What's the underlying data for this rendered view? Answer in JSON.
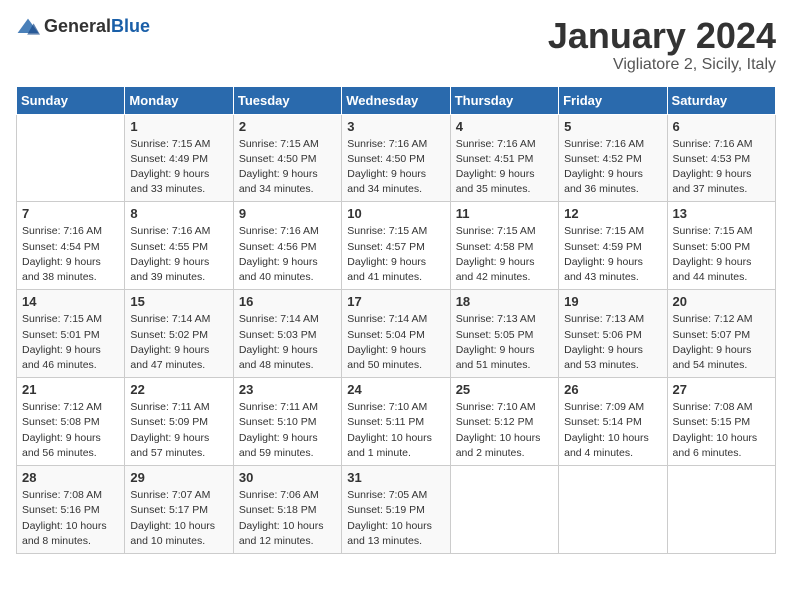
{
  "header": {
    "logo_general": "General",
    "logo_blue": "Blue",
    "title": "January 2024",
    "subtitle": "Vigliatore 2, Sicily, Italy"
  },
  "days_of_week": [
    "Sunday",
    "Monday",
    "Tuesday",
    "Wednesday",
    "Thursday",
    "Friday",
    "Saturday"
  ],
  "weeks": [
    [
      {
        "day": "",
        "info": ""
      },
      {
        "day": "1",
        "info": "Sunrise: 7:15 AM\nSunset: 4:49 PM\nDaylight: 9 hours\nand 33 minutes."
      },
      {
        "day": "2",
        "info": "Sunrise: 7:15 AM\nSunset: 4:50 PM\nDaylight: 9 hours\nand 34 minutes."
      },
      {
        "day": "3",
        "info": "Sunrise: 7:16 AM\nSunset: 4:50 PM\nDaylight: 9 hours\nand 34 minutes."
      },
      {
        "day": "4",
        "info": "Sunrise: 7:16 AM\nSunset: 4:51 PM\nDaylight: 9 hours\nand 35 minutes."
      },
      {
        "day": "5",
        "info": "Sunrise: 7:16 AM\nSunset: 4:52 PM\nDaylight: 9 hours\nand 36 minutes."
      },
      {
        "day": "6",
        "info": "Sunrise: 7:16 AM\nSunset: 4:53 PM\nDaylight: 9 hours\nand 37 minutes."
      }
    ],
    [
      {
        "day": "7",
        "info": "Sunrise: 7:16 AM\nSunset: 4:54 PM\nDaylight: 9 hours\nand 38 minutes."
      },
      {
        "day": "8",
        "info": "Sunrise: 7:16 AM\nSunset: 4:55 PM\nDaylight: 9 hours\nand 39 minutes."
      },
      {
        "day": "9",
        "info": "Sunrise: 7:16 AM\nSunset: 4:56 PM\nDaylight: 9 hours\nand 40 minutes."
      },
      {
        "day": "10",
        "info": "Sunrise: 7:15 AM\nSunset: 4:57 PM\nDaylight: 9 hours\nand 41 minutes."
      },
      {
        "day": "11",
        "info": "Sunrise: 7:15 AM\nSunset: 4:58 PM\nDaylight: 9 hours\nand 42 minutes."
      },
      {
        "day": "12",
        "info": "Sunrise: 7:15 AM\nSunset: 4:59 PM\nDaylight: 9 hours\nand 43 minutes."
      },
      {
        "day": "13",
        "info": "Sunrise: 7:15 AM\nSunset: 5:00 PM\nDaylight: 9 hours\nand 44 minutes."
      }
    ],
    [
      {
        "day": "14",
        "info": "Sunrise: 7:15 AM\nSunset: 5:01 PM\nDaylight: 9 hours\nand 46 minutes."
      },
      {
        "day": "15",
        "info": "Sunrise: 7:14 AM\nSunset: 5:02 PM\nDaylight: 9 hours\nand 47 minutes."
      },
      {
        "day": "16",
        "info": "Sunrise: 7:14 AM\nSunset: 5:03 PM\nDaylight: 9 hours\nand 48 minutes."
      },
      {
        "day": "17",
        "info": "Sunrise: 7:14 AM\nSunset: 5:04 PM\nDaylight: 9 hours\nand 50 minutes."
      },
      {
        "day": "18",
        "info": "Sunrise: 7:13 AM\nSunset: 5:05 PM\nDaylight: 9 hours\nand 51 minutes."
      },
      {
        "day": "19",
        "info": "Sunrise: 7:13 AM\nSunset: 5:06 PM\nDaylight: 9 hours\nand 53 minutes."
      },
      {
        "day": "20",
        "info": "Sunrise: 7:12 AM\nSunset: 5:07 PM\nDaylight: 9 hours\nand 54 minutes."
      }
    ],
    [
      {
        "day": "21",
        "info": "Sunrise: 7:12 AM\nSunset: 5:08 PM\nDaylight: 9 hours\nand 56 minutes."
      },
      {
        "day": "22",
        "info": "Sunrise: 7:11 AM\nSunset: 5:09 PM\nDaylight: 9 hours\nand 57 minutes."
      },
      {
        "day": "23",
        "info": "Sunrise: 7:11 AM\nSunset: 5:10 PM\nDaylight: 9 hours\nand 59 minutes."
      },
      {
        "day": "24",
        "info": "Sunrise: 7:10 AM\nSunset: 5:11 PM\nDaylight: 10 hours\nand 1 minute."
      },
      {
        "day": "25",
        "info": "Sunrise: 7:10 AM\nSunset: 5:12 PM\nDaylight: 10 hours\nand 2 minutes."
      },
      {
        "day": "26",
        "info": "Sunrise: 7:09 AM\nSunset: 5:14 PM\nDaylight: 10 hours\nand 4 minutes."
      },
      {
        "day": "27",
        "info": "Sunrise: 7:08 AM\nSunset: 5:15 PM\nDaylight: 10 hours\nand 6 minutes."
      }
    ],
    [
      {
        "day": "28",
        "info": "Sunrise: 7:08 AM\nSunset: 5:16 PM\nDaylight: 10 hours\nand 8 minutes."
      },
      {
        "day": "29",
        "info": "Sunrise: 7:07 AM\nSunset: 5:17 PM\nDaylight: 10 hours\nand 10 minutes."
      },
      {
        "day": "30",
        "info": "Sunrise: 7:06 AM\nSunset: 5:18 PM\nDaylight: 10 hours\nand 12 minutes."
      },
      {
        "day": "31",
        "info": "Sunrise: 7:05 AM\nSunset: 5:19 PM\nDaylight: 10 hours\nand 13 minutes."
      },
      {
        "day": "",
        "info": ""
      },
      {
        "day": "",
        "info": ""
      },
      {
        "day": "",
        "info": ""
      }
    ]
  ]
}
